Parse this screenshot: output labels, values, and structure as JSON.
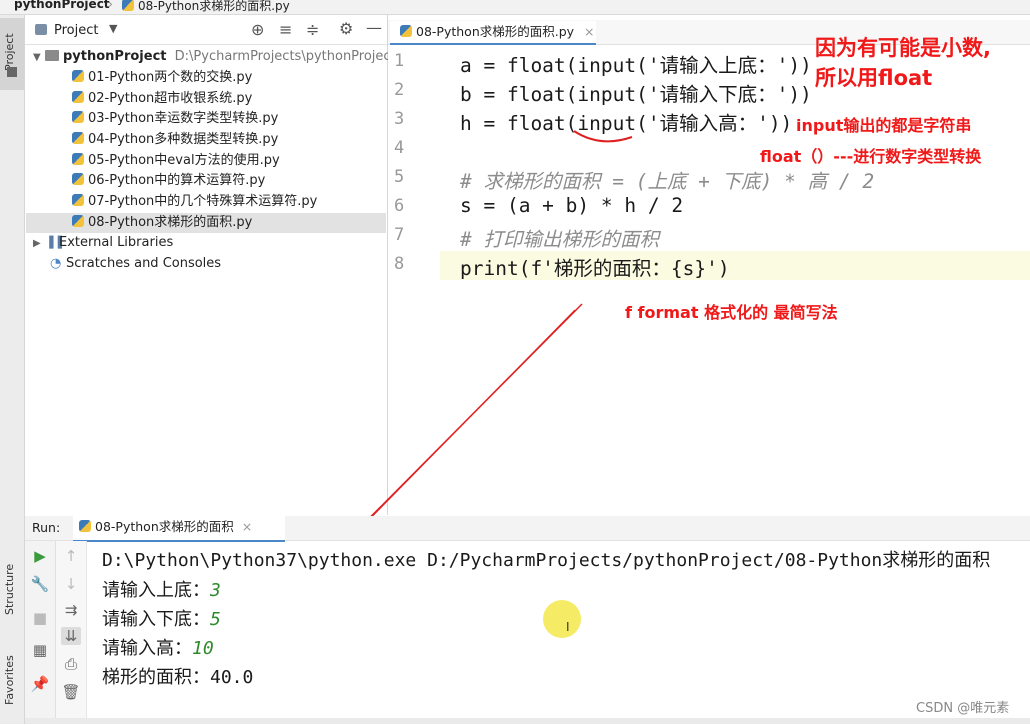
{
  "breadcrumb": {
    "project": "pythonProject",
    "file": "08-Python求梯形的面积.py"
  },
  "left_strip": {
    "project_tab": "Project",
    "structure_tab": "Structure",
    "favorites_tab": "Favorites"
  },
  "project_panel": {
    "title": "Project",
    "root": {
      "name": "pythonProject",
      "path": "D:\\PycharmProjects\\pythonProject"
    },
    "files": [
      "01-Python两个数的交换.py",
      "02-Python超市收银系统.py",
      "03-Python幸运数字类型转换.py",
      "04-Python多种数据类型转换.py",
      "05-Python中eval方法的使用.py",
      "06-Python中的算术运算符.py",
      "07-Python中的几个特殊算术运算符.py",
      "08-Python求梯形的面积.py"
    ],
    "external_libraries": "External Libraries",
    "scratches": "Scratches and Consoles"
  },
  "editor": {
    "tab_label": "08-Python求梯形的面积.py",
    "line_numbers": [
      "1",
      "2",
      "3",
      "4",
      "5",
      "6",
      "7",
      "8"
    ],
    "lines": [
      {
        "code": "a = float(input('请输入上底：'))"
      },
      {
        "code": "b = float(input('请输入下底：'))"
      },
      {
        "code": "h = float(input('请输入高：'))"
      },
      {
        "code": ""
      },
      {
        "code": "# 求梯形的面积 = (上底 + 下底) * 高 / 2"
      },
      {
        "code": "s = (a + b) * h / 2"
      },
      {
        "code": "# 打印输出梯形的面积"
      },
      {
        "code": "print(f'梯形的面积：{s}')"
      }
    ]
  },
  "annotations": {
    "note1_line1": "因为有可能是小数,",
    "note1_line2": "所以用float",
    "note2": "input输出的都是字符串",
    "note3": "float（）---进行数字类型转换",
    "note4": "f   format   格式化的 最简写法"
  },
  "run_panel": {
    "label": "Run:",
    "tab": "08-Python求梯形的面积",
    "output": [
      "D:\\Python\\Python37\\python.exe D:/PycharmProjects/pythonProject/08-Python求梯形的面积",
      "请输入上底：",
      "请输入下底：",
      "请输入高：",
      "梯形的面积：40.0"
    ],
    "inputs": [
      "3",
      "5",
      "10"
    ]
  },
  "watermark": "CSDN @唯元素",
  "colors": {
    "annotation_red": "#f01818",
    "keyword_blue": "#1e3f9c",
    "string_green": "#0a7a2a",
    "comment_gray": "#8c8c8c",
    "input_green": "#2d8a2d"
  }
}
